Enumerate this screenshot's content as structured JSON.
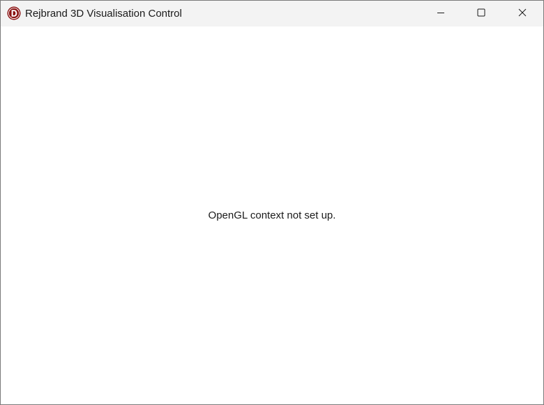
{
  "window": {
    "title": "Rejbrand 3D Visualisation Control",
    "app_icon": "delphi-d-icon",
    "controls": [
      "minimize-icon",
      "maximize-icon",
      "close-icon"
    ]
  },
  "client": {
    "message": "OpenGL context not set up."
  },
  "colors": {
    "titlebar_bg": "#f3f3f3",
    "client_bg": "#ffffff",
    "border": "#7a7a7a",
    "icon_red": "#8b1414"
  }
}
